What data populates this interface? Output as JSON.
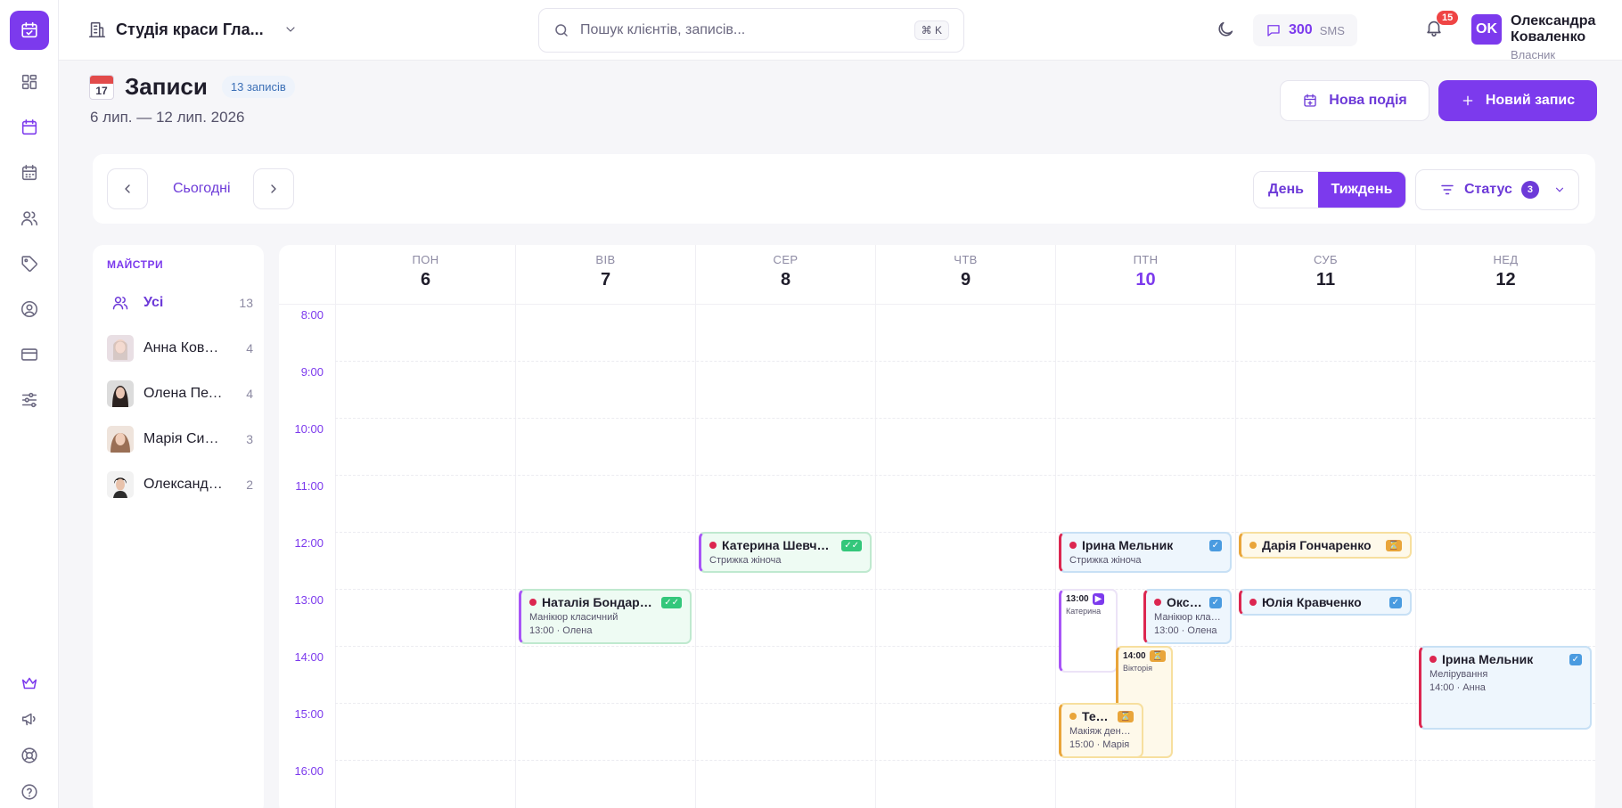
{
  "topbar": {
    "studio_name": "Студія краси Гла...",
    "search_placeholder": "Пошук клієнтів, записів...",
    "search_shortcut": "⌘ K",
    "sms_count": "300",
    "sms_label": "SMS",
    "notifications_count": "15",
    "user_initials": "OK",
    "user_name": "Олександра Коваленко",
    "user_role": "Власник"
  },
  "page": {
    "title": "Записи",
    "calendar_icon_day": "17",
    "records_badge": "13 записів",
    "date_range": "6 лип. — 12 лип. 2026",
    "new_event_label": "Нова подія",
    "new_record_label": "Новий запис"
  },
  "toolbar": {
    "today_label": "Сьогодні",
    "view_day": "День",
    "view_week": "Тиждень",
    "active_view": "Тиждень",
    "status_label": "Статус",
    "status_count": "3"
  },
  "masters": {
    "header": "МАЙСТРИ",
    "items": [
      {
        "name": "Усі",
        "count": "13"
      },
      {
        "name": "Анна Коваленко",
        "count": "4"
      },
      {
        "name": "Олена Петренко",
        "count": "4"
      },
      {
        "name": "Марія Сидоренко",
        "count": "3"
      },
      {
        "name": "Олександра Коваленко",
        "count": "2"
      }
    ]
  },
  "calendar": {
    "days": [
      {
        "wd": "ПОН",
        "num": "6"
      },
      {
        "wd": "ВІВ",
        "num": "7"
      },
      {
        "wd": "СЕР",
        "num": "8"
      },
      {
        "wd": "ЧТВ",
        "num": "9"
      },
      {
        "wd": "ПТН",
        "num": "10",
        "today": true
      },
      {
        "wd": "СУБ",
        "num": "11"
      },
      {
        "wd": "НЕД",
        "num": "12"
      }
    ],
    "hours": [
      "8:00",
      "9:00",
      "10:00",
      "11:00",
      "12:00",
      "13:00",
      "14:00",
      "15:00",
      "16:00"
    ],
    "events": [
      {
        "day": 2,
        "start": "12:00",
        "end": "12:45",
        "name": "Катерина Шевченко",
        "service": "Стрижка жіноча",
        "time_master": "",
        "status": "✓✓",
        "color": "green"
      },
      {
        "day": 1,
        "start": "13:00",
        "end": "14:00",
        "name": "Наталія Бондаренко",
        "service": "Манікюр класичний",
        "time_master": "13:00 · Олена",
        "status": "✓✓",
        "color": "green"
      },
      {
        "day": 4,
        "start": "12:00",
        "end": "12:45",
        "name": "Ірина Мельник",
        "service": "Стрижка жіноча",
        "time_master": "",
        "status": "✓",
        "color": "blue"
      },
      {
        "day": 4,
        "start": "13:00",
        "end": "14:30",
        "name": "",
        "service": "Катерина",
        "time_master": "13:00",
        "status": "▶",
        "color": "white",
        "mini": true
      },
      {
        "day": 4,
        "start": "13:00",
        "end": "14:00",
        "name": "Оксана",
        "service": "Манікюр класичний",
        "time_master": "13:00 · Олена",
        "status": "✓",
        "color": "blue"
      },
      {
        "day": 4,
        "start": "14:00",
        "end": "16:00",
        "name": "",
        "service": "Вікторія",
        "time_master": "14:00",
        "status": "⏳",
        "color": "yellow",
        "mini": true
      },
      {
        "day": 4,
        "start": "15:00",
        "end": "16:00",
        "name": "Тетяна",
        "service": "Макіяж денний",
        "time_master": "15:00 · Марія",
        "status": "⏳",
        "color": "yellow"
      },
      {
        "day": 5,
        "start": "12:00",
        "end": "12:30",
        "name": "Дарія Гончаренко",
        "service": "",
        "time_master": "",
        "status": "⏳",
        "color": "yellow"
      },
      {
        "day": 5,
        "start": "13:00",
        "end": "13:30",
        "name": "Юлія Кравченко",
        "service": "",
        "time_master": "",
        "status": "✓",
        "color": "blue"
      },
      {
        "day": 6,
        "start": "14:00",
        "end": "15:30",
        "name": "Ірина Мельник",
        "service": "Мелірування",
        "time_master": "14:00 · Анна",
        "status": "✓",
        "color": "blue"
      }
    ]
  },
  "colors": {
    "accent": "#7c3aed",
    "confirmed_green": "#34c77b",
    "confirmed_blue": "#4a9be0",
    "pending_yellow": "#e9a53a"
  },
  "icons": [
    "calendar-check-icon",
    "dashboard-icon",
    "calendar-icon",
    "calendar-grid-icon",
    "users-icon",
    "tag-icon",
    "user-circle-icon",
    "credit-card-icon",
    "sliders-icon",
    "crown-icon",
    "megaphone-icon",
    "lifebuoy-icon",
    "help-icon",
    "building-icon",
    "search-icon",
    "moon-icon",
    "message-icon",
    "bell-icon",
    "plus-icon",
    "filter-icon"
  ]
}
